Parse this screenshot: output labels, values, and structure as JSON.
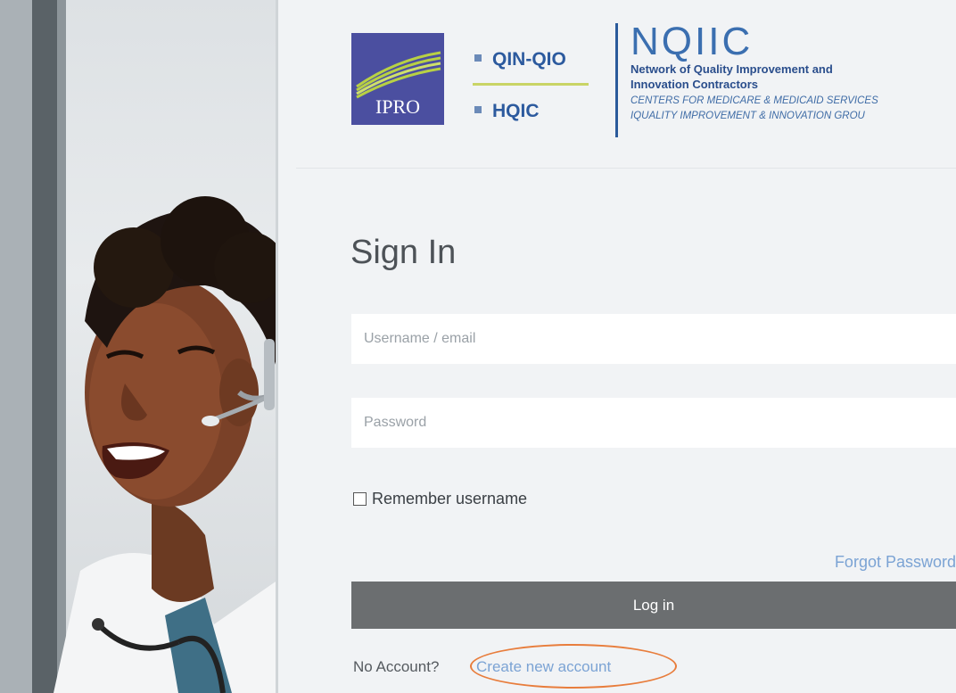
{
  "header": {
    "ipro_logo_text": "IPRO",
    "programs": [
      "QIN-QIO",
      "HQIC"
    ],
    "nqiic": {
      "title": "NQIIC",
      "line1": "Network of Quality Improvement and",
      "line2": "Innovation Contractors",
      "line3": "CENTERS FOR MEDICARE & MEDICAID SERVICES",
      "line4": "IQUALITY IMPROVEMENT & INNOVATION GROU"
    }
  },
  "form": {
    "title": "Sign In",
    "username_placeholder": "Username / email",
    "password_placeholder": "Password",
    "remember_label": "Remember username",
    "remember_checked": false,
    "forgot_label": "Forgot Password",
    "login_label": "Log in",
    "no_account_text": "No Account?",
    "create_account_label": "Create new account"
  },
  "colors": {
    "ipro_blue": "#4b4fa0",
    "link": "#7ba3d4",
    "button": "#6b6e70",
    "highlight": "#e87d3c"
  }
}
